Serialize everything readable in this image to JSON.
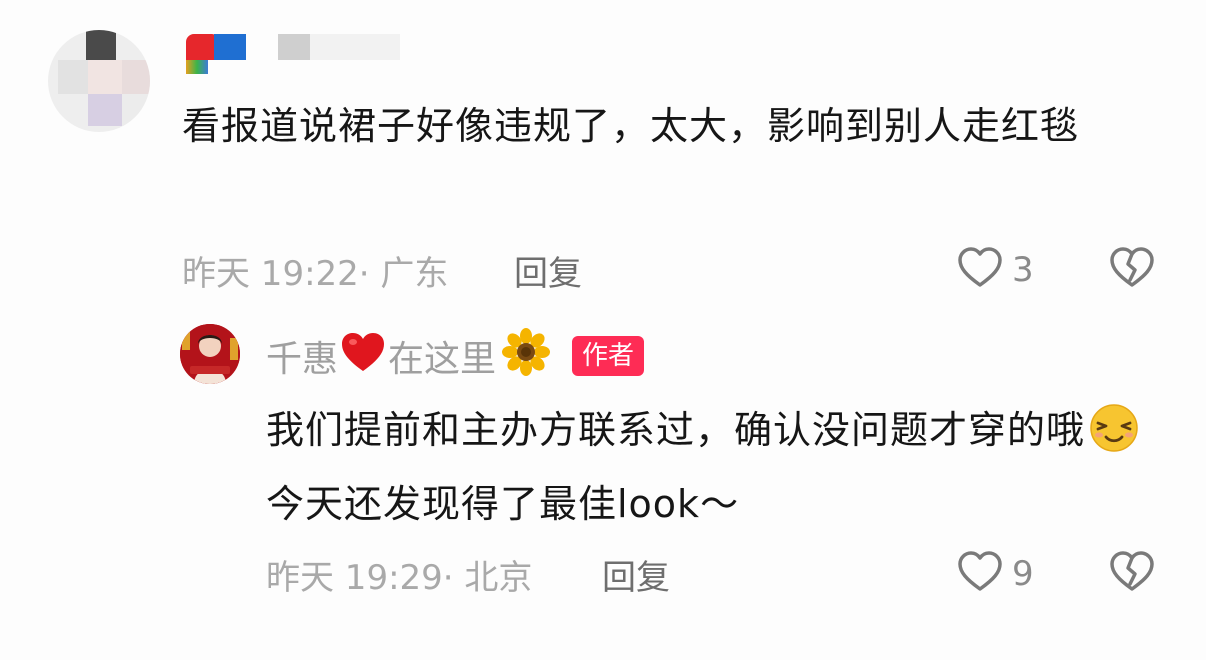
{
  "comments": [
    {
      "text": "看报道说裙子好像违规了，太大，影响到别人走红毯",
      "meta": "昨天 19:22· 广东",
      "reply_label": "回复",
      "likes": "3"
    },
    {
      "author": {
        "name": "千惠",
        "name_suffix": "在这里",
        "badge": "作者"
      },
      "text_part1": "我们提前和主办方联系过，确认没问题才穿的哦",
      "text_part2": "今天还发现得了最佳look～",
      "meta": "昨天 19:29· 北京",
      "reply_label": "回复",
      "likes": "9"
    }
  ],
  "colors": {
    "badge_bg": "#fe2c55",
    "text_primary": "#161616",
    "text_secondary": "#a9a9a9",
    "icon_stroke": "#7a7a7a"
  },
  "icons": {
    "like": "heart-outline-icon",
    "dislike": "broken-heart-icon",
    "heart_emoji": "red-heart-emoji",
    "flower_emoji": "sunflower-emoji",
    "face_emoji": "smiling-face-emoji"
  }
}
